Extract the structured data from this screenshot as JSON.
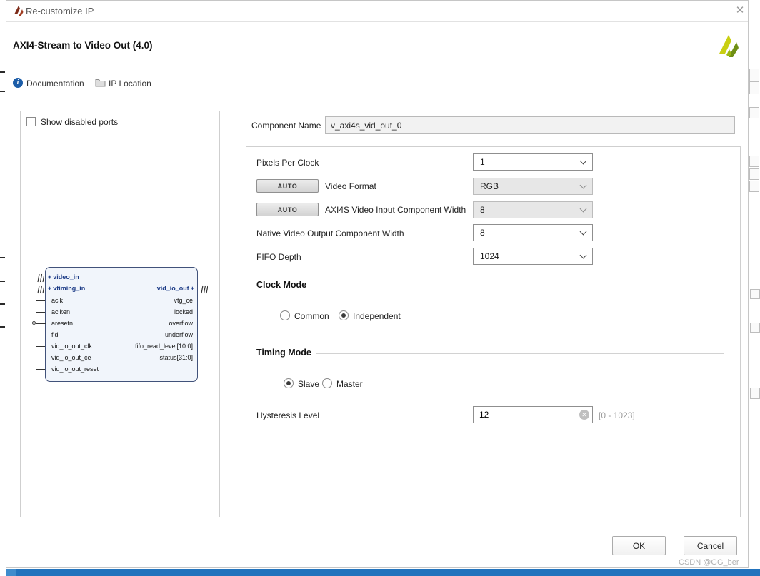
{
  "window": {
    "title": "Re-customize IP"
  },
  "icons": {
    "close": "✕",
    "info": "i",
    "clear": "✕",
    "expander": "+",
    "auto": "AUTO"
  },
  "header": {
    "title": "AXI4-Stream to Video Out (4.0)"
  },
  "toolbar": {
    "documentation": "Documentation",
    "ip_location": "IP Location"
  },
  "left_panel": {
    "show_disabled_ports": "Show disabled ports",
    "left_ports": [
      "video_in",
      "vtiming_in",
      "aclk",
      "aclken",
      "aresetn",
      "fid",
      "vid_io_out_clk",
      "vid_io_out_ce",
      "vid_io_out_reset"
    ],
    "right_ports": [
      "vid_io_out",
      "vtg_ce",
      "locked",
      "overflow",
      "underflow",
      "fifo_read_level[10:0]",
      "status[31:0]"
    ]
  },
  "form": {
    "component_name_label": "Component Name",
    "component_name_value": "v_axi4s_vid_out_0",
    "pixels_per_clock": {
      "label": "Pixels Per Clock",
      "value": "1"
    },
    "video_format": {
      "label": "Video Format",
      "value": "RGB"
    },
    "axi4s_width": {
      "label": "AXI4S Video Input Component Width",
      "value": "8"
    },
    "native_width": {
      "label": "Native Video Output Component Width",
      "value": "8"
    },
    "fifo_depth": {
      "label": "FIFO Depth",
      "value": "1024"
    },
    "clock_mode": {
      "title": "Clock Mode",
      "option_common": "Common",
      "option_independent": "Independent",
      "selected": "Independent"
    },
    "timing_mode": {
      "title": "Timing Mode",
      "option_slave": "Slave",
      "option_master": "Master",
      "selected": "Slave"
    },
    "hysteresis": {
      "label": "Hysteresis Level",
      "value": "12",
      "range": "[0 - 1023]"
    }
  },
  "footer": {
    "ok": "OK",
    "cancel": "Cancel"
  },
  "watermark": "CSDN @GG_ber",
  "colors": {
    "accent_blue": "#1c5da8",
    "taskbar_blue": "#2273bd",
    "block_border": "#41527a",
    "logo_yellow": "#c9cf12",
    "logo_green": "#6f8f14"
  }
}
